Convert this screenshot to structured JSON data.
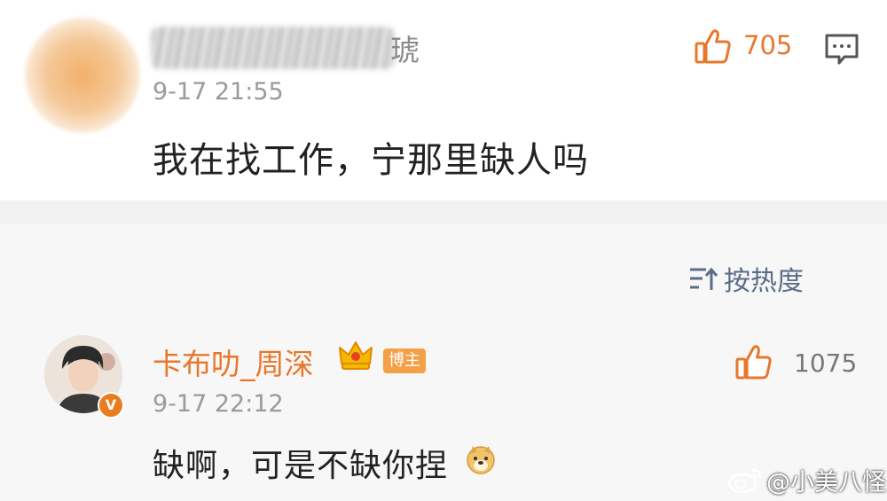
{
  "colors": {
    "accent_orange": "#e8772b",
    "gray_text": "#9a9a9a",
    "sort_blue": "#5a6d88",
    "page_bg": "#f2f2f2",
    "card_bg": "#ffffff"
  },
  "comment1": {
    "username_visible_tail": "琥",
    "time": "9-17 21:55",
    "text": "我在找工作，宁那里缺人吗",
    "like_count": "705",
    "icons": [
      "thumbs-up-icon",
      "comment-reply-icon"
    ]
  },
  "sort": {
    "label": "按热度",
    "icon": "sort-icon"
  },
  "comment2": {
    "username": "卡布叻_周深",
    "badge": "博主",
    "time": "9-17 22:12",
    "text": "缺啊，可是不缺你捏",
    "like_count": "1075",
    "icons": [
      "crown-icon",
      "verified-v-icon",
      "doge-emoji-icon",
      "thumbs-up-icon"
    ],
    "verified_mark": "V"
  },
  "watermark": {
    "text": "@小美八怪",
    "icon": "weibo-logo-icon"
  }
}
